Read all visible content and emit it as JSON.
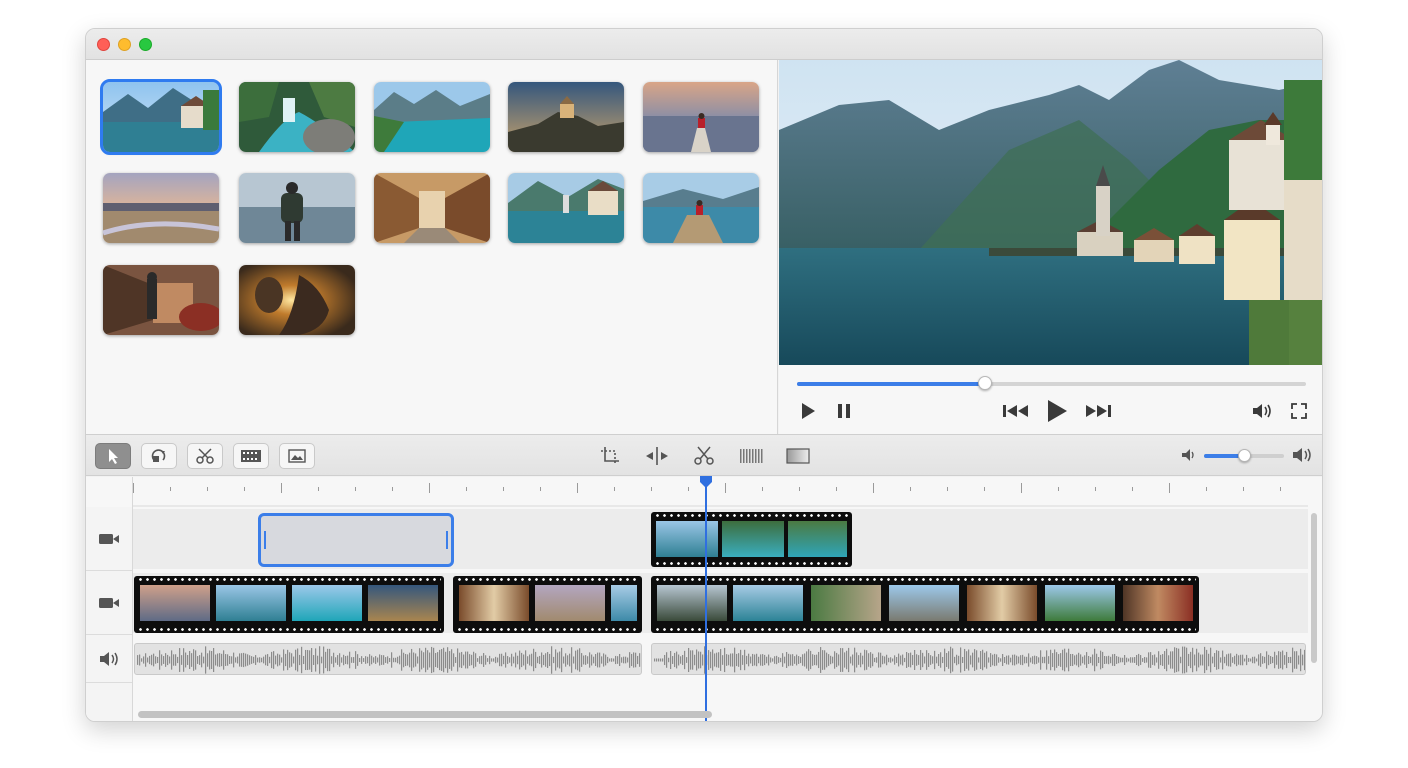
{
  "window": {
    "traffic_lights": [
      "close",
      "minimize",
      "zoom"
    ]
  },
  "media_browser": {
    "clips": [
      {
        "name": "hallstatt-lake",
        "selected": true
      },
      {
        "name": "mountain-river"
      },
      {
        "name": "turquoise-lake"
      },
      {
        "name": "castle-hill"
      },
      {
        "name": "person-on-pier-sunset"
      },
      {
        "name": "wetland-sunset"
      },
      {
        "name": "hiker-lake"
      },
      {
        "name": "old-town-street"
      },
      {
        "name": "village-lakeside"
      },
      {
        "name": "pier-sitting"
      },
      {
        "name": "city-street-traveler"
      },
      {
        "name": "hand-sunflare"
      }
    ]
  },
  "viewer": {
    "playback_progress": 0.37,
    "controls": [
      "play-icon",
      "pause-icon",
      "skip-back-icon",
      "play-large-icon",
      "skip-forward-icon",
      "volume-icon",
      "fullscreen-icon"
    ]
  },
  "toolbar": {
    "tools": [
      "select-icon",
      "rotate-icon",
      "scissors-icon",
      "film-icon",
      "image-icon"
    ],
    "center_tools": [
      "crop-icon",
      "split-icon",
      "cut-icon",
      "audio-detach-icon",
      "color-icon"
    ],
    "master_volume": 0.5
  },
  "timeline": {
    "playhead_position": 0.48,
    "tracks": [
      {
        "name": "video-track-upper",
        "icon": "camera-icon"
      },
      {
        "name": "video-track-main",
        "icon": "camera-icon"
      },
      {
        "name": "audio-track",
        "icon": "speaker-icon"
      }
    ]
  },
  "colors": {
    "accent": "#2f7bf0",
    "progress": "#3c7ee8"
  }
}
